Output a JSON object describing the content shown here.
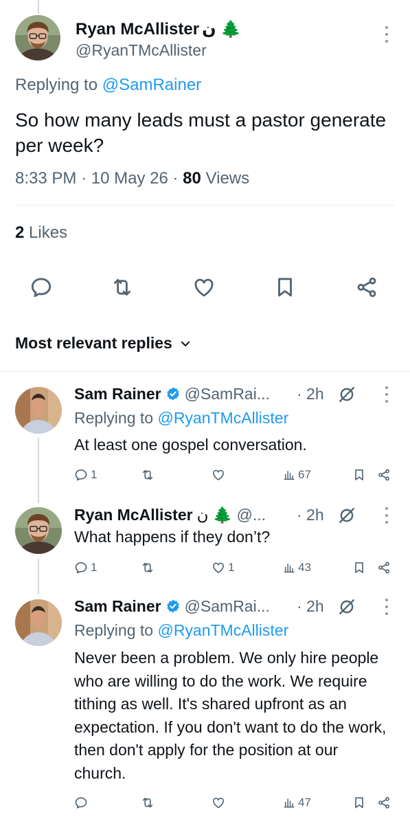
{
  "main_tweet": {
    "author_name": "Ryan McAllister",
    "author_emoji": "ن 🌲",
    "handle": "@RyanTMcAllister",
    "replying_prefix": "Replying to ",
    "replying_handle": "@SamRainer",
    "text": "So how many leads must a pastor generate per week?",
    "time": "8:33 PM",
    "date": "10 May 26",
    "views_count": "80",
    "views_label": " Views",
    "likes_count": "2",
    "likes_label": " Likes"
  },
  "sort_label": "Most relevant replies",
  "replies": [
    {
      "name": "Sam Rainer",
      "verified": true,
      "handle": "@SamRai...",
      "time": "· 2h",
      "replying_prefix": "Replying to ",
      "replying_handle": "@RyanTMcAllister",
      "text": "At least one gospel conversation.",
      "reply_count": "1",
      "like_count": "",
      "views": "67"
    },
    {
      "name": "Ryan McAllister",
      "emoji": "ن 🌲",
      "handle": "@...",
      "time": "· 2h",
      "text": "What happens if they don’t?",
      "reply_count": "1",
      "like_count": "1",
      "views": "43"
    },
    {
      "name": "Sam Rainer",
      "verified": true,
      "handle": "@SamRai...",
      "time": "· 2h",
      "replying_prefix": "Replying to ",
      "replying_handle": "@RyanTMcAllister",
      "text": "Never been a problem. We only hire people who are willing to do the work. We require tithing as well. It's shared upfront as an expectation. If you don't want to do the work, then don't apply for the position at our church.",
      "reply_count": "",
      "like_count": "",
      "views": "47"
    }
  ],
  "icons": {
    "reply": "reply-icon",
    "retweet": "retweet-icon",
    "like": "heart-icon",
    "bookmark": "bookmark-icon",
    "share": "share-icon",
    "views": "views-icon",
    "grok": "grok-icon",
    "verified": "verified-badge-icon"
  },
  "colors": {
    "link": "#1d9bf0",
    "secondary_text": "#536471",
    "verified": "#1d9bf0"
  }
}
